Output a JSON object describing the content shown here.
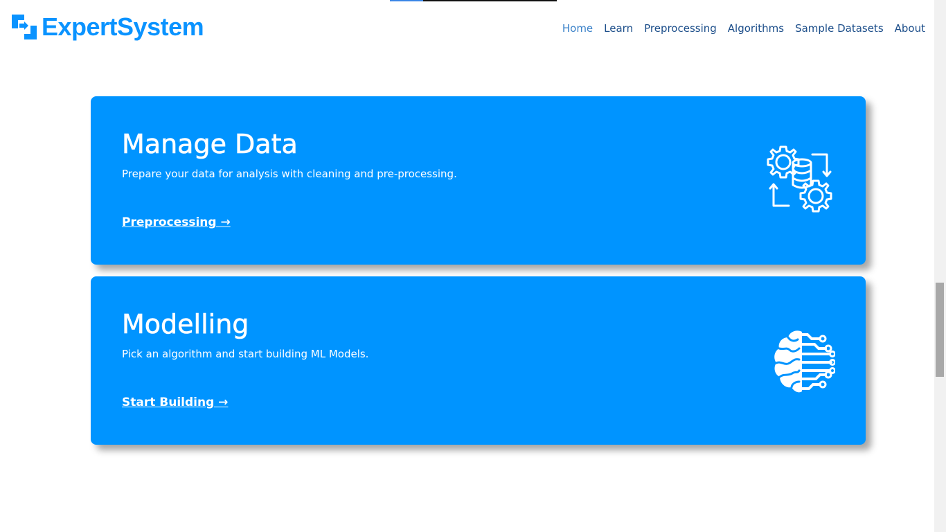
{
  "brand": {
    "name": "ExpertSystem",
    "color": "#0a93ff"
  },
  "nav": {
    "items": [
      {
        "label": "Home",
        "active": true
      },
      {
        "label": "Learn"
      },
      {
        "label": "Preprocessing"
      },
      {
        "label": "Algorithms"
      },
      {
        "label": "Sample Datasets"
      },
      {
        "label": "About"
      }
    ]
  },
  "cards": [
    {
      "title": "Manage Data",
      "description": "Prepare your data for analysis with cleaning and pre-processing.",
      "link": "Preprocessing →",
      "icon": "gears-database-icon"
    },
    {
      "title": "Modelling",
      "description": "Pick an algorithm and start building ML Models.",
      "link": "Start Building →",
      "icon": "brain-circuit-icon"
    }
  ],
  "colors": {
    "card_background": "#0094ff",
    "nav_text": "#1c4e8a",
    "nav_active": "#3b82c9"
  }
}
